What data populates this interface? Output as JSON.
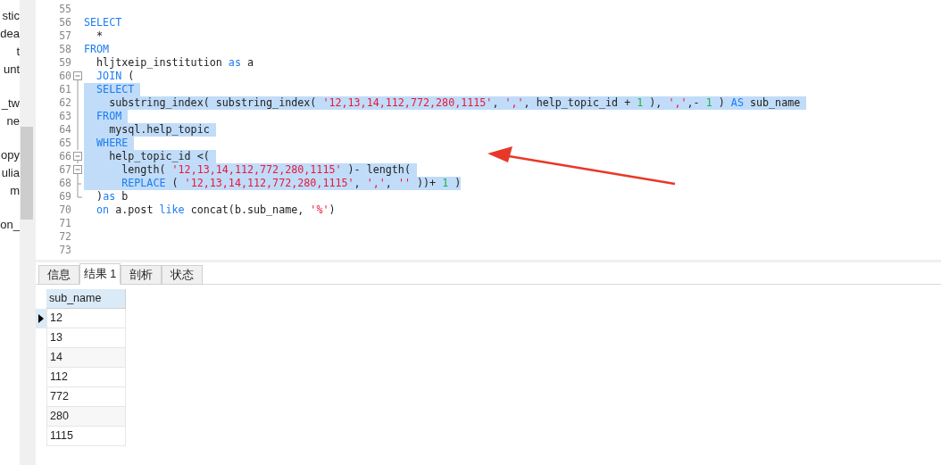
{
  "sidebar": {
    "items": [
      {
        "kind": "text",
        "text": "stic"
      },
      {
        "kind": "text",
        "text": "dea"
      },
      {
        "kind": "text",
        "text": "t"
      },
      {
        "kind": "text",
        "text": "unt"
      },
      {
        "kind": "blank"
      },
      {
        "kind": "text",
        "text": "_tw"
      },
      {
        "kind": "text",
        "text": "ne"
      },
      {
        "kind": "blank"
      },
      {
        "kind": "text",
        "text": "opy"
      },
      {
        "kind": "text",
        "text": "ulia"
      },
      {
        "kind": "text",
        "text": "m"
      },
      {
        "kind": "blank"
      },
      {
        "kind": "text",
        "text": "on_"
      }
    ]
  },
  "editor": {
    "lines": [
      {
        "number": "55",
        "kind": "plain"
      },
      {
        "number": "56",
        "kind": "plain",
        "segments": [
          {
            "selected": false,
            "tokens": [
              {
                "kind": "keyword",
                "text": "SELECT"
              }
            ]
          }
        ]
      },
      {
        "number": "57",
        "kind": "plain",
        "segments": [
          {
            "selected": false,
            "tokens": [
              {
                "kind": "plain",
                "text": "  *"
              }
            ]
          }
        ]
      },
      {
        "number": "58",
        "kind": "plain",
        "segments": [
          {
            "selected": false,
            "tokens": [
              {
                "kind": "keyword",
                "text": "FROM"
              }
            ]
          }
        ]
      },
      {
        "number": "59",
        "kind": "plain",
        "segments": [
          {
            "selected": false,
            "tokens": [
              {
                "kind": "plain",
                "text": "  hljtxeip_institution"
              },
              {
                "kind": "keyword",
                "text": " as"
              },
              {
                "kind": "plain",
                "text": " a"
              }
            ]
          }
        ]
      },
      {
        "number": "60",
        "kind": "fold_start",
        "segments": [
          {
            "selected": false,
            "tokens": [
              {
                "kind": "keyword",
                "text": "  JOIN"
              },
              {
                "kind": "plain",
                "text": " ("
              }
            ]
          }
        ]
      },
      {
        "number": "61",
        "kind": "fold_inner",
        "segments": [
          {
            "selected": true,
            "tokens": [
              {
                "kind": "keyword",
                "text": "  SELECT "
              }
            ]
          }
        ]
      },
      {
        "number": "62",
        "kind": "fold_inner",
        "segments": [
          {
            "selected": true,
            "tokens": [
              {
                "kind": "plain",
                "text": "    substring_index( substring_index("
              },
              {
                "kind": "string",
                "text": " '12,13,14,112,772,280,1115'"
              },
              {
                "kind": "plain",
                "text": ","
              },
              {
                "kind": "string",
                "text": " ','"
              },
              {
                "kind": "plain",
                "text": ", help_topic_id +"
              },
              {
                "kind": "number",
                "text": " 1"
              },
              {
                "kind": "plain",
                "text": " ),"
              },
              {
                "kind": "string",
                "text": " ','"
              },
              {
                "kind": "plain",
                "text": ",-"
              },
              {
                "kind": "number",
                "text": " 1"
              },
              {
                "kind": "plain",
                "text": " )"
              },
              {
                "kind": "keyword",
                "text": " AS"
              },
              {
                "kind": "plain",
                "text": " sub_name "
              }
            ]
          }
        ]
      },
      {
        "number": "63",
        "kind": "fold_inner",
        "segments": [
          {
            "selected": true,
            "tokens": [
              {
                "kind": "keyword",
                "text": "  FROM "
              }
            ]
          }
        ]
      },
      {
        "number": "64",
        "kind": "fold_inner",
        "segments": [
          {
            "selected": true,
            "tokens": [
              {
                "kind": "plain",
                "text": "    mysql.help_topic "
              }
            ]
          }
        ]
      },
      {
        "number": "65",
        "kind": "fold_inner",
        "segments": [
          {
            "selected": true,
            "tokens": [
              {
                "kind": "keyword",
                "text": "  WHERE "
              }
            ]
          }
        ]
      },
      {
        "number": "66",
        "kind": "fold_start",
        "segments": [
          {
            "selected": true,
            "tokens": [
              {
                "kind": "plain",
                "text": "    help_topic_id <( "
              }
            ]
          }
        ]
      },
      {
        "number": "67",
        "kind": "fold_start",
        "segments": [
          {
            "selected": true,
            "tokens": [
              {
                "kind": "plain",
                "text": "      length("
              },
              {
                "kind": "string",
                "text": " '12,13,14,112,772,280,1115'"
              },
              {
                "kind": "plain",
                "text": " )- length( "
              }
            ]
          }
        ]
      },
      {
        "number": "68",
        "kind": "fold_branch",
        "segments": [
          {
            "selected": true,
            "tokens": [
              {
                "kind": "keyword",
                "text": "      REPLACE"
              },
              {
                "kind": "plain",
                "text": " ("
              },
              {
                "kind": "string",
                "text": " '12,13,14,112,772,280,1115'"
              },
              {
                "kind": "plain",
                "text": ","
              },
              {
                "kind": "string",
                "text": " ','"
              },
              {
                "kind": "plain",
                "text": ","
              },
              {
                "kind": "string",
                "text": " ''"
              },
              {
                "kind": "plain",
                "text": " ))+"
              },
              {
                "kind": "number",
                "text": " 1"
              },
              {
                "kind": "plain",
                "text": " )"
              }
            ]
          }
        ]
      },
      {
        "number": "69",
        "kind": "fold_end",
        "segments": [
          {
            "selected": false,
            "tokens": [
              {
                "kind": "plain",
                "text": "  )"
              },
              {
                "kind": "keyword",
                "text": "as"
              },
              {
                "kind": "plain",
                "text": " b"
              }
            ]
          }
        ]
      },
      {
        "number": "70",
        "kind": "plain",
        "segments": [
          {
            "selected": false,
            "tokens": [
              {
                "kind": "keyword",
                "text": "  on"
              },
              {
                "kind": "plain",
                "text": " a.post"
              },
              {
                "kind": "keyword",
                "text": " like"
              },
              {
                "kind": "plain",
                "text": " concat(b.sub_name,"
              },
              {
                "kind": "string",
                "text": " '%'"
              },
              {
                "kind": "plain",
                "text": ")"
              }
            ]
          }
        ]
      },
      {
        "number": "71",
        "kind": "plain"
      },
      {
        "number": "72",
        "kind": "plain"
      },
      {
        "number": "73",
        "kind": "plain"
      }
    ]
  },
  "tabs": [
    {
      "label": "信息",
      "selected": false
    },
    {
      "label": "结果 1",
      "selected": true
    },
    {
      "label": "剖析",
      "selected": false
    },
    {
      "label": "状态",
      "selected": false
    }
  ],
  "result": {
    "columns": [
      "sub_name"
    ],
    "rows": [
      {
        "selected": true,
        "cells": [
          "12"
        ]
      },
      {
        "selected": false,
        "cells": [
          "13"
        ]
      },
      {
        "selected": false,
        "cells": [
          "14"
        ]
      },
      {
        "selected": false,
        "cells": [
          "112"
        ]
      },
      {
        "selected": false,
        "cells": [
          "772"
        ]
      },
      {
        "selected": false,
        "cells": [
          "280"
        ]
      },
      {
        "selected": false,
        "cells": [
          "1115"
        ]
      }
    ]
  }
}
